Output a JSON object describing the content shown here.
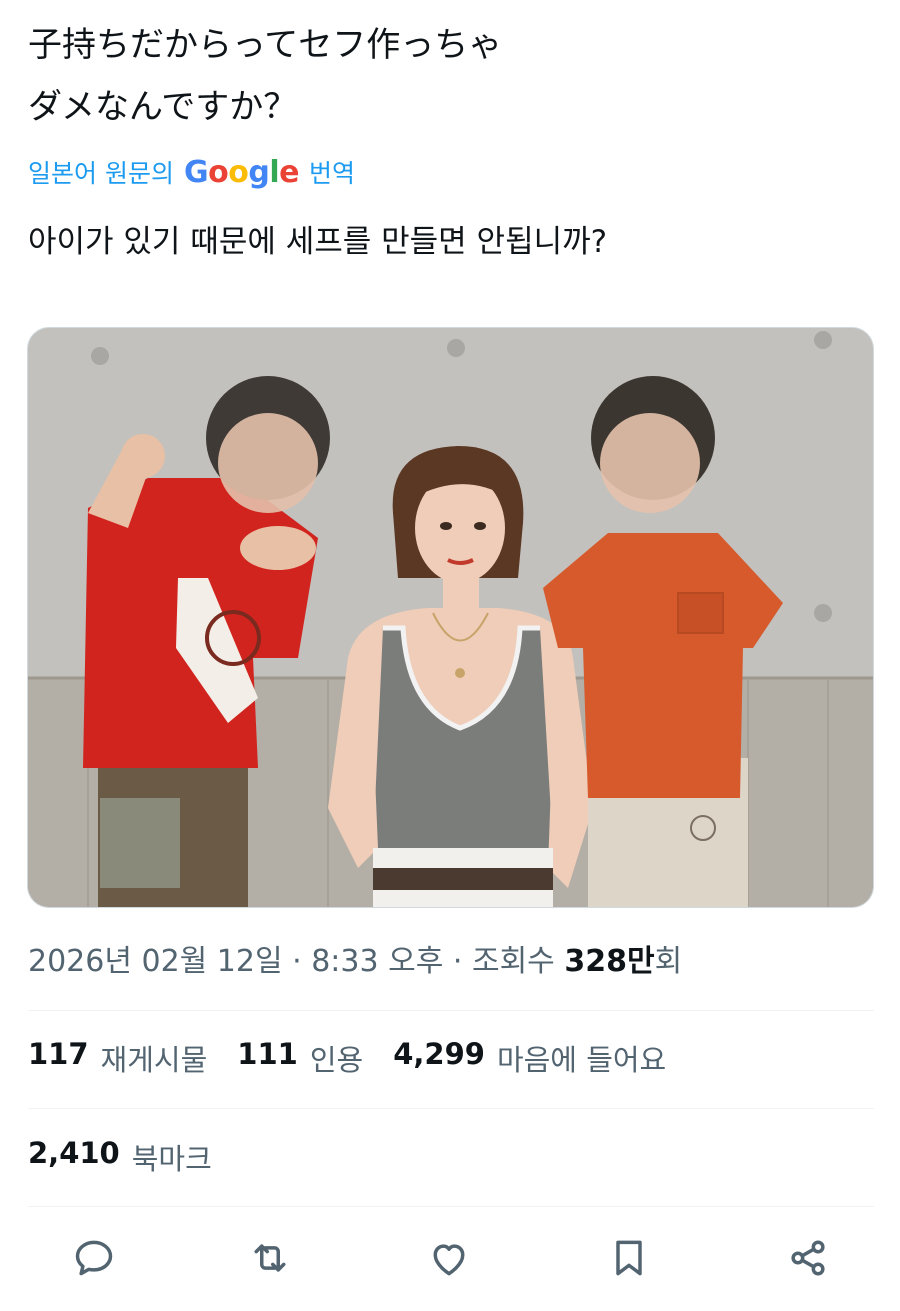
{
  "tweet": {
    "text_jp": "子持ちだからってセフ作っちゃ\nダメなんですか？",
    "translate": {
      "prefix": "일본어 원문의",
      "brand": [
        "G",
        "o",
        "o",
        "g",
        "l",
        "e"
      ],
      "brand_colors": [
        "#4285F4",
        "#EA4335",
        "#FBBC05",
        "#4285F4",
        "#34A853",
        "#EA4335"
      ],
      "suffix": "번역"
    },
    "text_ko": "아이가 있기 때문에 세프를 만들면 안됩니까?"
  },
  "meta": {
    "date": "2026년 02월 12일",
    "sep1": "·",
    "time": "8:33 오후",
    "sep2": "·",
    "views_label": "조회수",
    "views_count": "328만",
    "views_suffix": "회"
  },
  "stats": {
    "retweets": {
      "num": "117",
      "label": "재게시물"
    },
    "quotes": {
      "num": "111",
      "label": "인용"
    },
    "likes": {
      "num": "4,299",
      "label": "마음에 들어요"
    },
    "bookmarks": {
      "num": "2,410",
      "label": "북마크"
    }
  },
  "actions": {
    "icons": [
      "reply-icon",
      "retweet-icon",
      "like-icon",
      "bookmark-icon",
      "share-icon"
    ],
    "icon_color": "#536471"
  },
  "colors": {
    "accent": "#1d9bf0",
    "text_primary": "#0f1419",
    "text_secondary": "#536471"
  }
}
